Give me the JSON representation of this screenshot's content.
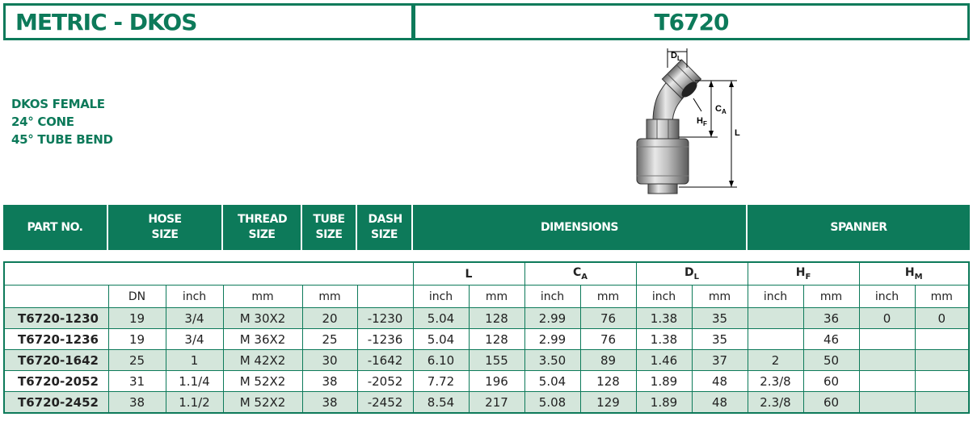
{
  "header": {
    "family": "METRIC - DKOS",
    "part_code": "T6720"
  },
  "description": {
    "line1": "DKOS FEMALE",
    "line2": "24° CONE",
    "line3": "45° TUBE BEND"
  },
  "drawing": {
    "labels": {
      "dl": "D",
      "dl_sub": "L",
      "ca": "C",
      "ca_sub": "A",
      "hf": "H",
      "hf_sub": "F",
      "l": "L"
    }
  },
  "band": {
    "part_no": "PART NO.",
    "hose_size": "HOSE SIZE",
    "thread_size": "THREAD SIZE",
    "tube_size": "TUBE SIZE",
    "dash_size": "DASH SIZE",
    "dimensions": "DIMENSIONS",
    "spanner": "SPANNER"
  },
  "groups": {
    "l": "L",
    "ca": "C",
    "ca_sub": "A",
    "dl": "D",
    "dl_sub": "L",
    "hf": "H",
    "hf_sub": "F",
    "hm": "H",
    "hm_sub": "M"
  },
  "units": [
    "DN",
    "inch",
    "mm",
    "mm",
    "",
    "inch",
    "mm",
    "inch",
    "mm",
    "inch",
    "mm",
    "inch",
    "mm",
    "inch",
    "mm"
  ],
  "rows": [
    [
      "T6720-1230",
      "19",
      "3/4",
      "M 30X2",
      "20",
      "-1230",
      "5.04",
      "128",
      "2.99",
      "76",
      "1.38",
      "35",
      "",
      "36",
      "0",
      "0"
    ],
    [
      "T6720-1236",
      "19",
      "3/4",
      "M 36X2",
      "25",
      "-1236",
      "5.04",
      "128",
      "2.99",
      "76",
      "1.38",
      "35",
      "",
      "46",
      "",
      ""
    ],
    [
      "T6720-1642",
      "25",
      "1",
      "M 42X2",
      "30",
      "-1642",
      "6.10",
      "155",
      "3.50",
      "89",
      "1.46",
      "37",
      "2",
      "50",
      "",
      ""
    ],
    [
      "T6720-2052",
      "31",
      "1.1/4",
      "M 52X2",
      "38",
      "-2052",
      "7.72",
      "196",
      "5.04",
      "128",
      "1.89",
      "48",
      "2.3/8",
      "60",
      "",
      ""
    ],
    [
      "T6720-2452",
      "38",
      "1.1/2",
      "M 52X2",
      "38",
      "-2452",
      "8.54",
      "217",
      "5.08",
      "129",
      "1.89",
      "48",
      "2.3/8",
      "60",
      "",
      ""
    ]
  ]
}
